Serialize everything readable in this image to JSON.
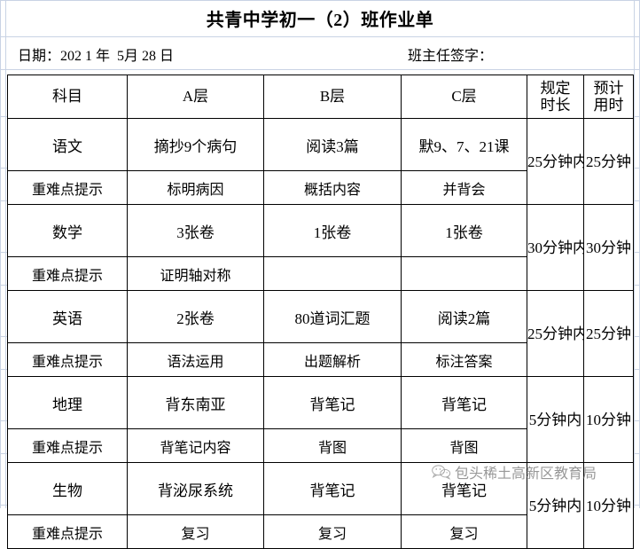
{
  "document": {
    "title": "共青中学初一（2）班作业单",
    "date_label": "日期：202 1 年  5月 28 日",
    "signature_label": "班主任签字："
  },
  "table": {
    "headers": {
      "subject": "科目",
      "level_a": "A层",
      "level_b": "B层",
      "required_time_line1": "规定",
      "required_time_line2": "时长",
      "estimated_time_line1": "预计",
      "estimated_time_line2": "用时",
      "level_c": "C层"
    },
    "hint_label": "重难点提示",
    "rows": [
      {
        "subject": "语文",
        "a": "摘抄9个病句",
        "b": "阅读3篇",
        "c": "默9、7、21课",
        "required_time": "25分钟内",
        "estimated_time": "25分钟",
        "hint_label": "重难点提示",
        "hint_a": "标明病因",
        "hint_b": "概括内容",
        "hint_c": "并背会"
      },
      {
        "subject": "数学",
        "a": "3张卷",
        "b": "1张卷",
        "c": "1张卷",
        "required_time": "30分钟内",
        "estimated_time": "30分钟",
        "hint_label": "重难点提示",
        "hint_a": "证明轴对称",
        "hint_b": "",
        "hint_c": ""
      },
      {
        "subject": "英语",
        "a": "2张卷",
        "b": "80道词汇题",
        "c": "阅读2篇",
        "required_time": "25分钟内",
        "estimated_time": "25分钟",
        "hint_label": "重难点提示",
        "hint_a": "语法运用",
        "hint_b": "出题解析",
        "hint_c": "标注答案"
      },
      {
        "subject": "地理",
        "a": "背东南亚",
        "b": "背笔记",
        "c": "背笔记",
        "required_time": "5分钟内",
        "estimated_time": "10分钟",
        "hint_label": "重难点提示",
        "hint_a": "背笔记内容",
        "hint_b": "背图",
        "hint_c": "背图"
      },
      {
        "subject": "生物",
        "a": "背泌尿系统",
        "b": "背笔记",
        "c": "背笔记",
        "required_time": "5分钟内",
        "estimated_time": "10分钟",
        "hint_label": "重难点提示",
        "hint_a": "复习",
        "hint_b": "复习",
        "hint_c": "复习"
      }
    ]
  },
  "watermark": {
    "text": "包头稀土高新区教育局",
    "icon": "wechat-bubble-icon",
    "color": "#5a5a5a"
  },
  "colors": {
    "gridline": "#c9d3e4",
    "border": "#000000",
    "text": "#000000"
  }
}
